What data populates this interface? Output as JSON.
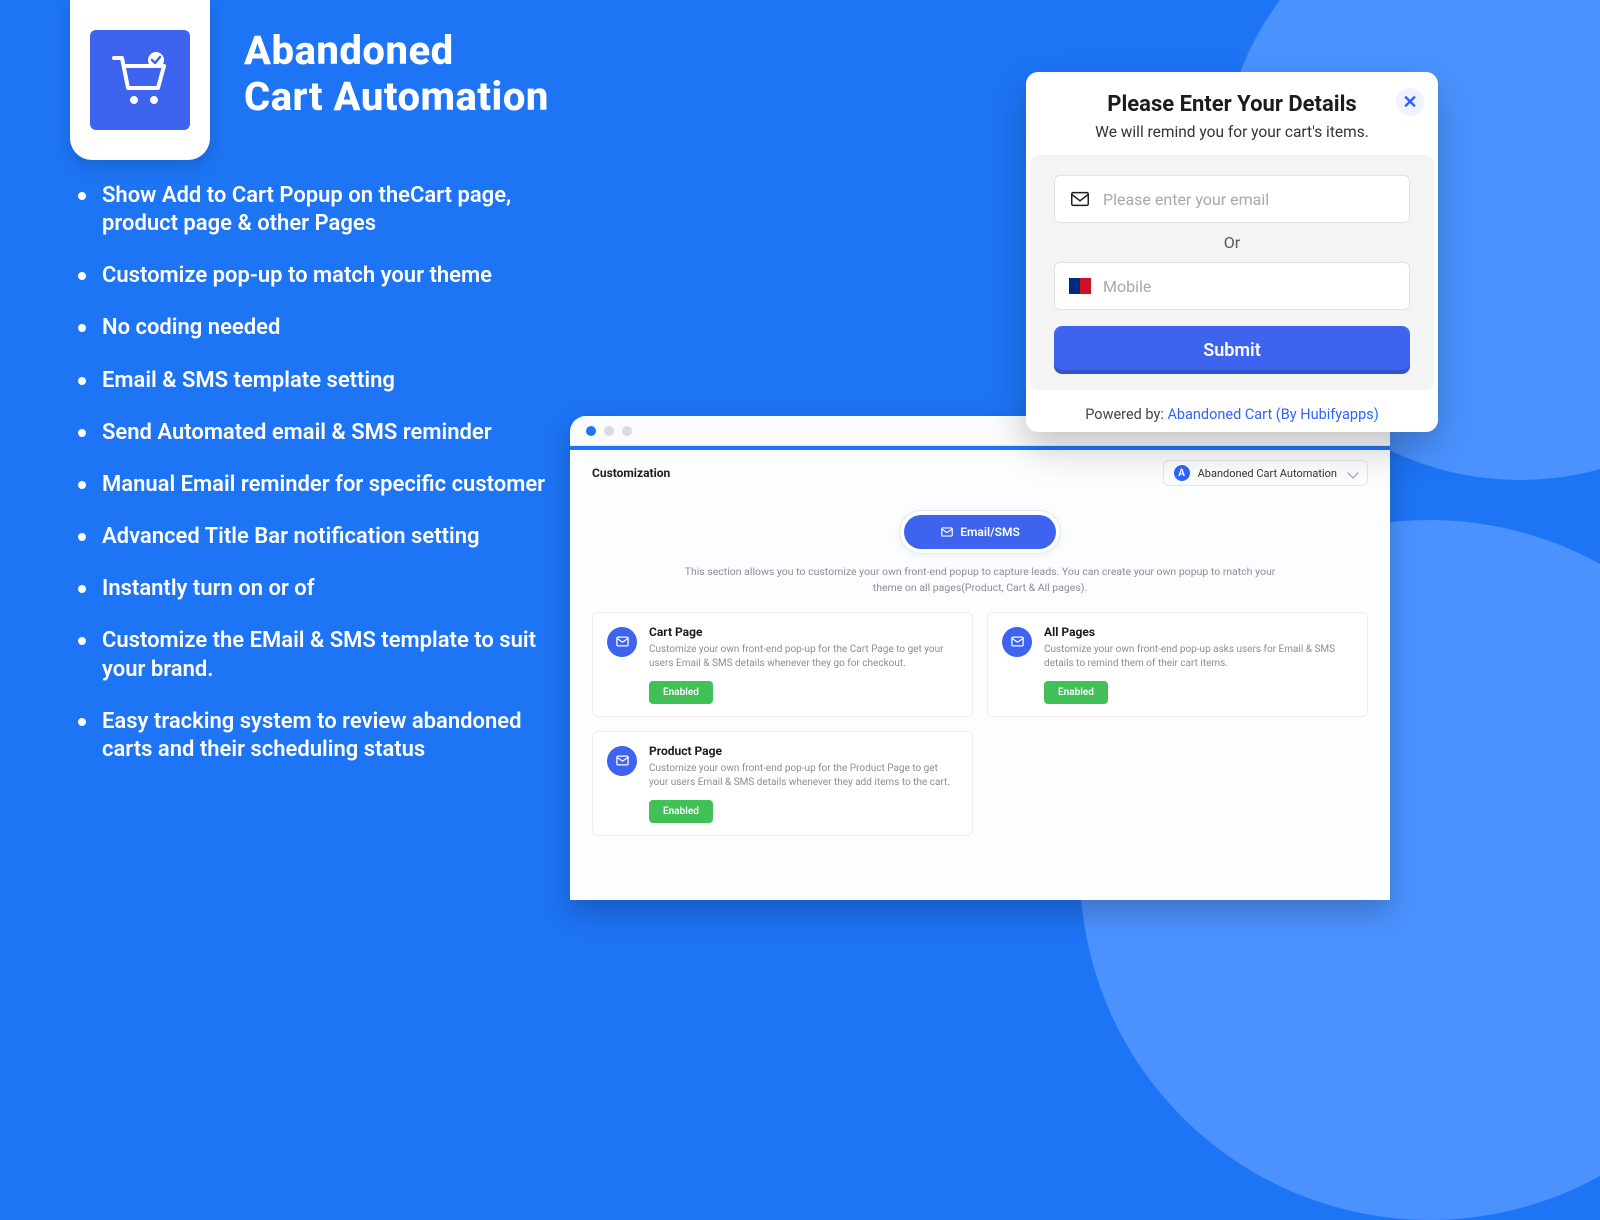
{
  "title": {
    "line1": "Abandoned",
    "line2": "Cart Automation"
  },
  "bullets": [
    "Show Add to Cart Popup on theCart page, product page & other Pages",
    "Customize pop-up to match your theme",
    "No coding needed",
    "Email & SMS template setting",
    "Send Automated email & SMS reminder",
    "Manual Email reminder for specific customer",
    "Advanced Title Bar notification setting",
    "Instantly turn on or of",
    "Customize the EMail & SMS template to suit your brand.",
    "Easy tracking system to review abandoned carts and their scheduling status"
  ],
  "popup": {
    "title": "Please Enter Your Details",
    "subtitle": "We will remind you for your cart's items.",
    "email_placeholder": "Please enter your email",
    "or_label": "Or",
    "mobile_placeholder": "Mobile",
    "submit_label": "Submit",
    "powered_prefix": "Powered by: ",
    "powered_link": "Abandoned Cart (By Hubifyapps)"
  },
  "dashboard": {
    "crumb": "Customization",
    "store_label": "Abandoned Cart Automation",
    "store_badge": "A",
    "pill_label": "Email/SMS",
    "description": "This section allows you to customize your own front-end popup to capture leads. You can create your own popup to match your theme on all pages(Product, Cart & All pages).",
    "cards": [
      {
        "title": "Cart Page",
        "desc": "Customize your own front-end pop-up for the Cart Page to get your users Email & SMS details whenever they go for checkout.",
        "action": "Enabled"
      },
      {
        "title": "All Pages",
        "desc": "Customize your own front-end pop-up asks users for Email & SMS details to remind them of their cart items.",
        "action": "Enabled"
      },
      {
        "title": "Product Page",
        "desc": "Customize your own front-end pop-up for the Product Page to get your users Email & SMS details whenever they add items to the cart.",
        "action": "Enabled"
      }
    ]
  }
}
